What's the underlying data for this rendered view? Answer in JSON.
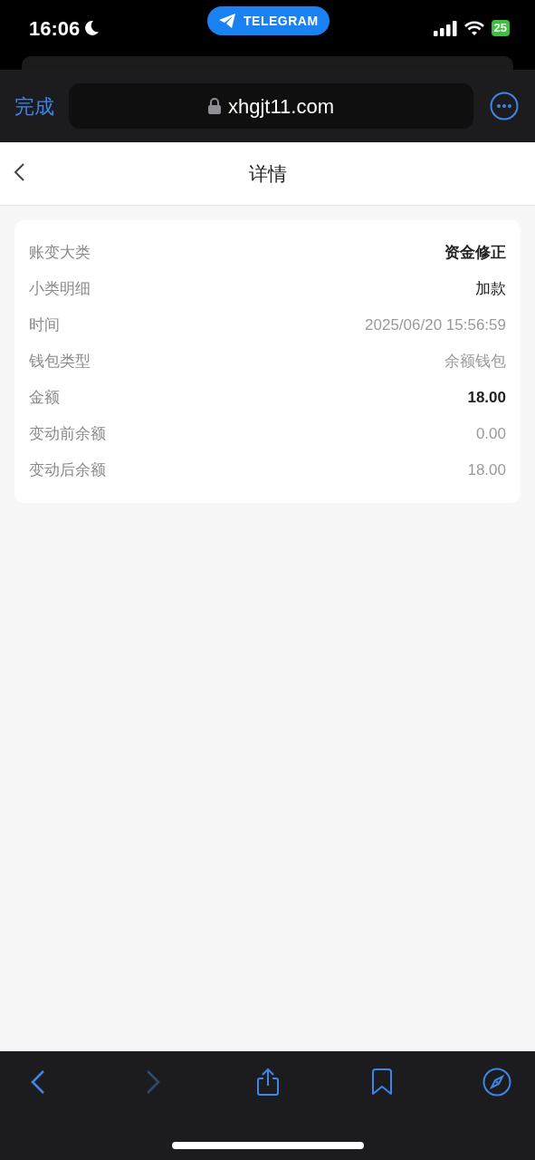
{
  "status_bar": {
    "time": "16:06",
    "app_pill": "TELEGRAM",
    "battery": "25"
  },
  "browser_bar": {
    "done": "完成",
    "url": "xhgjt11.com"
  },
  "header": {
    "title": "详情"
  },
  "details": [
    {
      "label": "账变大类",
      "value": "资金修正",
      "kind": "strong"
    },
    {
      "label": "小类明细",
      "value": "加款",
      "kind": "plain"
    },
    {
      "label": "时间",
      "value": "2025/06/20 15:56:59",
      "kind": "muted"
    },
    {
      "label": "钱包类型",
      "value": "余额钱包",
      "kind": "muted"
    },
    {
      "label": "金额",
      "value": "18.00",
      "kind": "strong"
    },
    {
      "label": "变动前余额",
      "value": "0.00",
      "kind": "muted"
    },
    {
      "label": "变动后余额",
      "value": "18.00",
      "kind": "muted"
    }
  ],
  "toolbar": {
    "back_disabled": false,
    "forward_disabled": true
  }
}
